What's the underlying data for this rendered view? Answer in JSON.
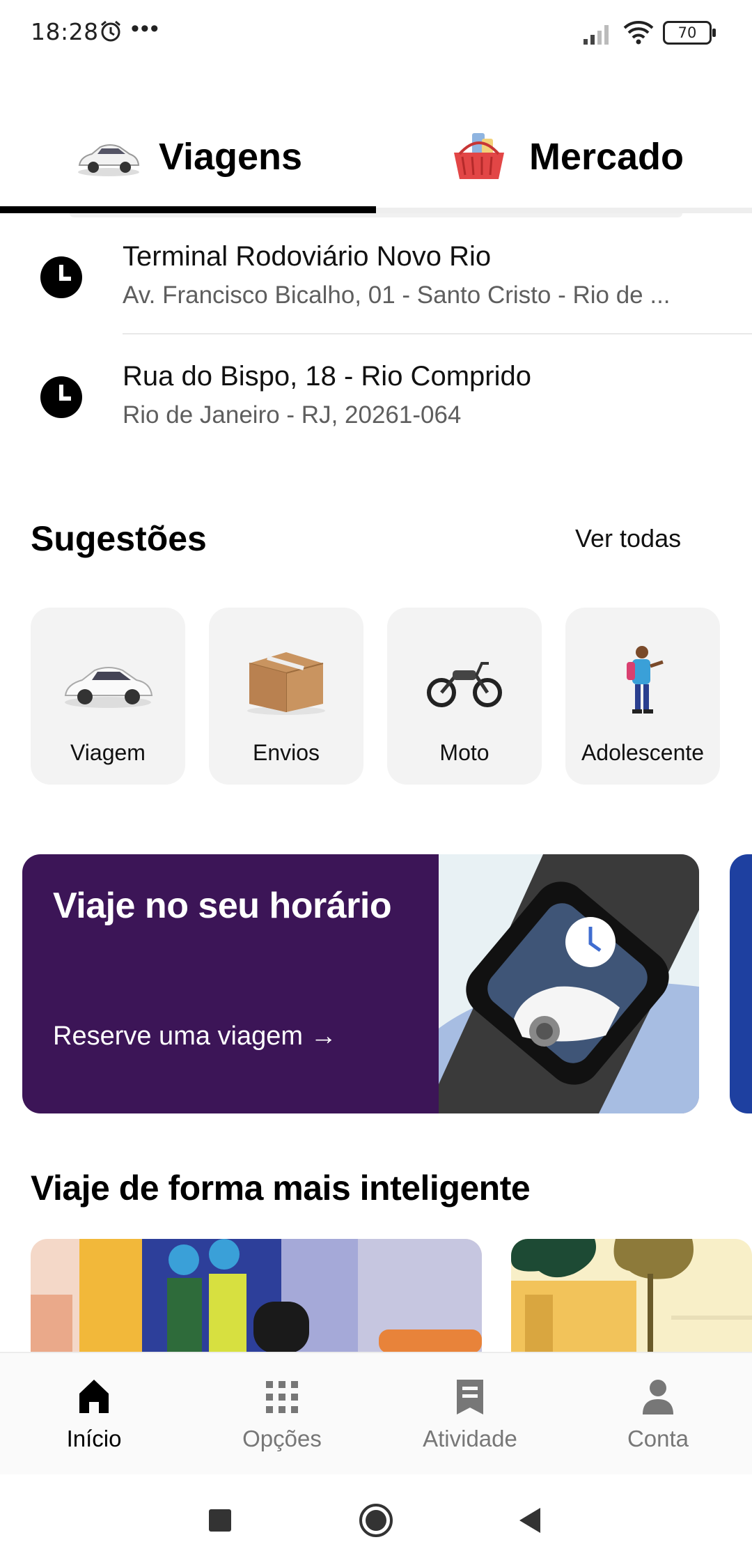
{
  "status_bar": {
    "time": "18:28",
    "dots": "•••",
    "battery": "70"
  },
  "tabs": [
    {
      "label": "Viagens",
      "icon": "car-icon",
      "active": true
    },
    {
      "label": "Mercado",
      "icon": "grocery-basket-icon",
      "active": false
    }
  ],
  "recent": [
    {
      "title": "Terminal Rodoviário Novo Rio",
      "subtitle": "Av. Francisco Bicalho, 01 - Santo Cristo - Rio de ..."
    },
    {
      "title": "Rua do Bispo, 18 - Rio Comprido",
      "subtitle": "Rio de Janeiro - RJ, 20261-064"
    }
  ],
  "suggestions": {
    "title": "Sugestões",
    "see_all": "Ver todas",
    "items": [
      {
        "label": "Viagem",
        "icon": "car-icon"
      },
      {
        "label": "Envios",
        "icon": "package-icon"
      },
      {
        "label": "Moto",
        "icon": "motorcycle-icon"
      },
      {
        "label": "Adolescente",
        "icon": "teen-icon"
      }
    ]
  },
  "banner": {
    "title": "Viaje no seu horário",
    "cta": "Reserve uma viagem →",
    "bg_color": "#3c1557"
  },
  "smart": {
    "title": "Viaje de forma mais inteligente"
  },
  "bottom_nav": [
    {
      "label": "Início",
      "icon": "home-icon",
      "active": true
    },
    {
      "label": "Opções",
      "icon": "grid-icon",
      "active": false
    },
    {
      "label": "Atividade",
      "icon": "receipt-icon",
      "active": false
    },
    {
      "label": "Conta",
      "icon": "person-icon",
      "active": false
    }
  ]
}
